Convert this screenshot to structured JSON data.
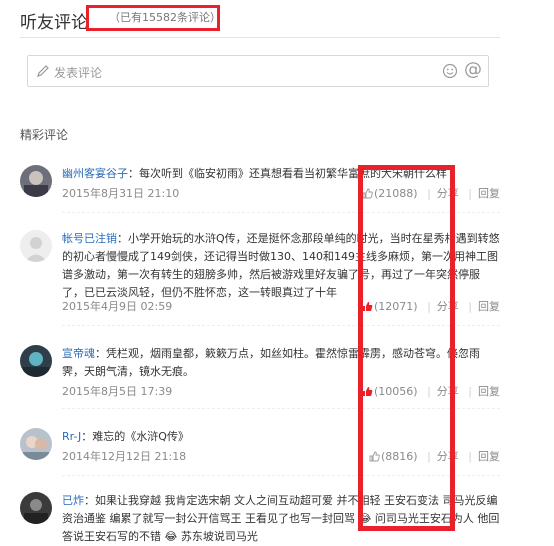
{
  "header": {
    "title": "听友评论",
    "count_text": "（已有15582条评论）"
  },
  "composer": {
    "placeholder": "发表评论",
    "at_symbol": "@"
  },
  "section_title": "精彩评论",
  "actions": {
    "share": "分享",
    "reply": "回复"
  },
  "comments": [
    {
      "user": "幽州客宴谷子",
      "text": "每次听到《临安初雨》还真想看看当初繁华富庶的大宋朝什么样",
      "time": "2015年8月31日 21:10",
      "likes": "(21088)"
    },
    {
      "user": "帐号已注销",
      "text": "小学开始玩的水浒Q传，还是挺怀念那段单纯的时光，当时在星秀村遇到转悠的初心者慢慢成了149剑侠，还记得当时做130、140和149主线多麻烦，第一次用神工图谱多激动，第一次有转生的翅膀多帅，然后被游戏里好友骗了号，再过了一年突然停服了，已已云淡风轻，但仍不胜怀恋，这一转眼真过了十年",
      "time": "2015年4月9日 02:59",
      "likes": "(12071)"
    },
    {
      "user": "宣帝魂",
      "text": "凭栏观，烟雨皇都，簌簌万点，如丝如柱。霍然惊雷霹雳，感动苍穹。倏忽雨霁，天朗气清，镜水无痕。",
      "time": "2015年8月5日 17:39",
      "likes": "(10056)"
    },
    {
      "user": "Rr-J",
      "text": "难忘的《水浒Q传》",
      "time": "2014年12月12日 21:18",
      "likes": "(8816)"
    },
    {
      "user": "已炸",
      "text": "如果让我穿越 我肯定选宋朝 文人之间互动超可爱 并不相轻 王安石变法 司马光反编资治通鉴 编累了就写一封公开信骂王 王看见了也写一封回骂 😂 问司马光王安石为人 他回答说王安石写的不错 😂 苏东坡说司马光",
      "time": "",
      "likes": ""
    }
  ],
  "colors": {
    "highlight": "#e8212b",
    "username": "#2a6cba",
    "like_red": "#e8212b"
  }
}
